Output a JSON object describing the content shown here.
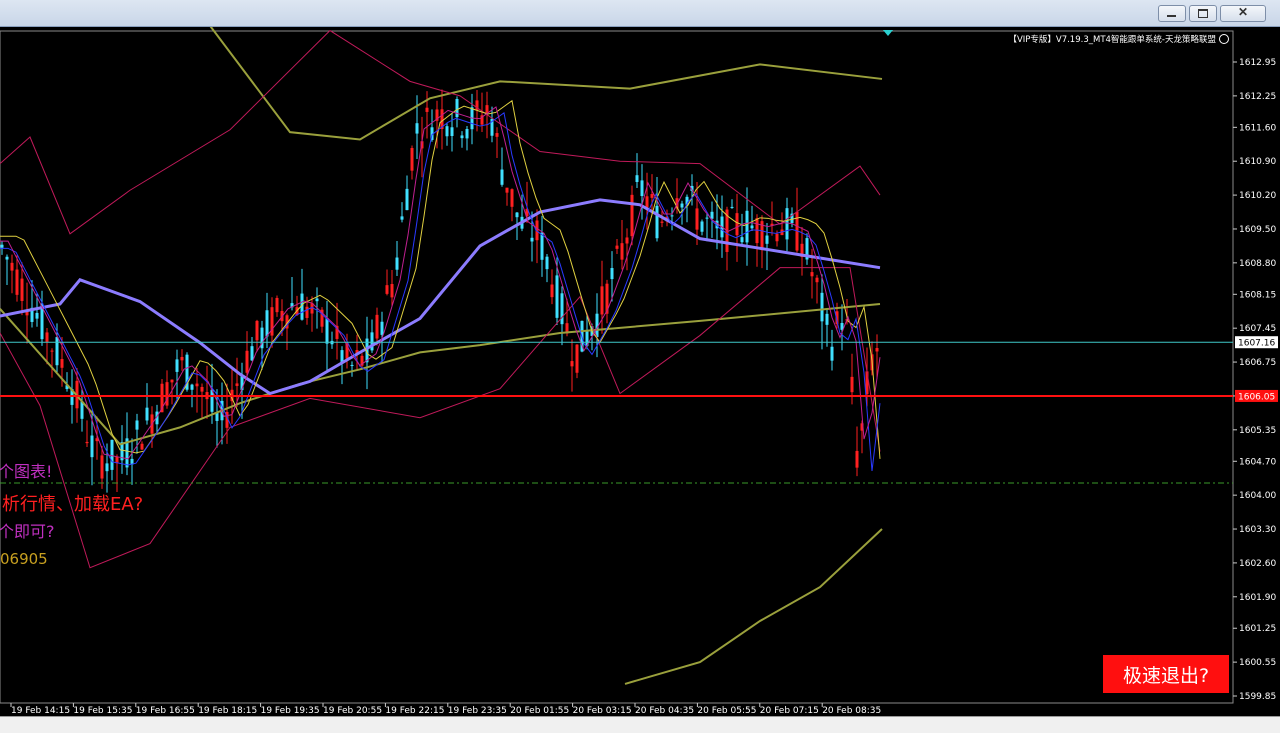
{
  "window": {
    "minimize_label": "",
    "maximize_label": "",
    "close_label": "✕"
  },
  "header": {
    "info_text": "【VIP专版】V7.19.3_MT4智能跟单系统-天龙策略联盟",
    "smiley_icon": "smiley-icon"
  },
  "overlay": {
    "line1": "个图表!",
    "line2": "析行情、加载EA?",
    "line3": "个即可?",
    "line4": "06905",
    "exit_button": "极速退出?"
  },
  "colors": {
    "background": "#000000",
    "bull_candle": "#40e0ff",
    "bear_candle": "#ff2020",
    "ma_slow": "#9aa03c",
    "ma_mid": "#8c7cff",
    "bollinger": "#c01a5a",
    "fast_ma_yellow": "#e0d040",
    "fast_ma_blue": "#2a3aff",
    "fast_ma_magenta": "#c02090",
    "price_line": "#3fc8c8",
    "support_line": "#ff1010",
    "dashed_line": "#3a9a2a",
    "axis_text": "#ffffff",
    "overlay_magenta": "#c030c0",
    "overlay_red": "#ff2020",
    "overlay_gold": "#c8a020"
  },
  "chart_data": {
    "type": "candlestick",
    "title": "",
    "xlabel": "",
    "ylabel": "",
    "ylim": [
      1599.85,
      1613.3
    ],
    "y_ticks": [
      "1612.95",
      "1612.25",
      "1611.60",
      "1610.90",
      "1610.20",
      "1609.50",
      "1608.80",
      "1608.15",
      "1607.45",
      "1606.75",
      "1606.05",
      "1605.35",
      "1604.70",
      "1604.00",
      "1603.30",
      "1602.60",
      "1601.90",
      "1601.25",
      "1600.55",
      "1599.85"
    ],
    "x_ticks": [
      "19 Feb 14:15",
      "19 Feb 15:35",
      "19 Feb 16:55",
      "19 Feb 18:15",
      "19 Feb 19:35",
      "19 Feb 20:55",
      "19 Feb 22:15",
      "19 Feb 23:35",
      "20 Feb 01:55",
      "20 Feb 03:15",
      "20 Feb 04:35",
      "20 Feb 05:55",
      "20 Feb 07:15",
      "20 Feb 08:35"
    ],
    "current_price": {
      "value": 1607.16,
      "label": "1607.16"
    },
    "support_level": {
      "value": 1606.05,
      "label": "1606.05"
    },
    "dashed_level": {
      "value": 1604.25
    },
    "legend": [],
    "series": [
      {
        "name": "slow MA",
        "values": [
          1607.85,
          1605.05,
          1605.4,
          1605.9,
          1606.3,
          1606.6,
          1606.95,
          1607.1,
          1607.35,
          1607.6,
          1607.95
        ]
      },
      {
        "name": "upper slow band",
        "values": [
          1614.4,
          1613.7,
          1611.5,
          1611.35,
          1612.2,
          1612.55,
          1612.4,
          1612.9,
          1612.6
        ]
      },
      {
        "name": "lower slow band",
        "values": [
          1600.1,
          1600.55,
          1601.4,
          1602.1,
          1603.3
        ]
      },
      {
        "name": "mid MA",
        "values": [
          1607.7,
          1607.95,
          1608.45,
          1608.0,
          1607.15,
          1606.5,
          1606.1,
          1606.35,
          1606.95,
          1607.65,
          1609.15,
          1609.85,
          1610.1,
          1610.0,
          1609.3,
          1609.1,
          1608.9,
          1608.7
        ]
      },
      {
        "name": "bollinger upper",
        "values": [
          1610.85,
          1611.4,
          1609.4,
          1610.3,
          1611.55,
          1613.6,
          1612.55,
          1612.25,
          1611.1,
          1610.9,
          1610.85,
          1609.6,
          1610.8,
          1610.2
        ]
      },
      {
        "name": "bollinger lower",
        "values": [
          1607.35,
          1605.85,
          1602.5,
          1603.0,
          1605.4,
          1606.0,
          1605.6,
          1606.2,
          1608.1,
          1606.1,
          1607.3,
          1608.7,
          1608.7,
          1604.9
        ]
      }
    ]
  }
}
